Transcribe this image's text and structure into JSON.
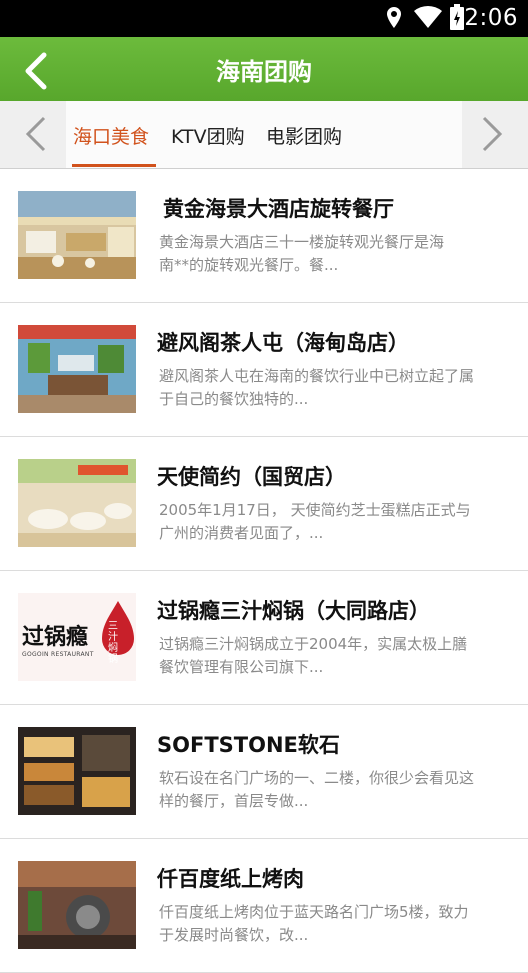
{
  "status_bar": {
    "time": "2:06",
    "icons": [
      "location-icon",
      "wifi-icon",
      "battery-icon"
    ]
  },
  "header": {
    "title": "海南团购",
    "back_icon": "back-arrow-icon",
    "color": "#5fae33"
  },
  "tabs": {
    "items": [
      {
        "label": "海口美食",
        "active": true
      },
      {
        "label": "KTV团购",
        "active": false
      },
      {
        "label": "电影团购",
        "active": false
      }
    ],
    "accent": "#d1521c",
    "left_icon": "chevron-left-icon",
    "right_icon": "chevron-right-icon"
  },
  "list": [
    {
      "title": "黄金海景大酒店旋转餐厅",
      "desc": "黄金海景大酒店三十一楼旋转观光餐厅是海\n南**的旋转观光餐厅。餐..."
    },
    {
      "title": "避风阁茶人屯（海甸岛店）",
      "desc": "避风阁茶人屯在海南的餐饮行业中已树立起了属\n于自己的餐饮独特的..."
    },
    {
      "title": "天使简约（国贸店）",
      "desc": "2005年1月17日， 天使简约芝士蛋糕店正式与\n广州的消费者见面了，..."
    },
    {
      "title": "过锅瘾三汁焖锅（大同路店）",
      "desc": "过锅瘾三汁焖锅成立于2004年，实属太极上膳\n餐饮管理有限公司旗下...",
      "logo_text": "过锅瘾",
      "logo_side": "三汁焖锅",
      "logo_sub": "GOGOIN RESTAURANT"
    },
    {
      "title": "SOFTSTONE软石",
      "desc": "软石设在名门广场的一、二楼，你很少会看见这\n样的餐厅，首层专做..."
    },
    {
      "title": "仟百度纸上烤肉",
      "desc": "仟百度纸上烤肉位于蓝天路名门广场5楼，致力\n于发展时尚餐饮，改..."
    }
  ]
}
